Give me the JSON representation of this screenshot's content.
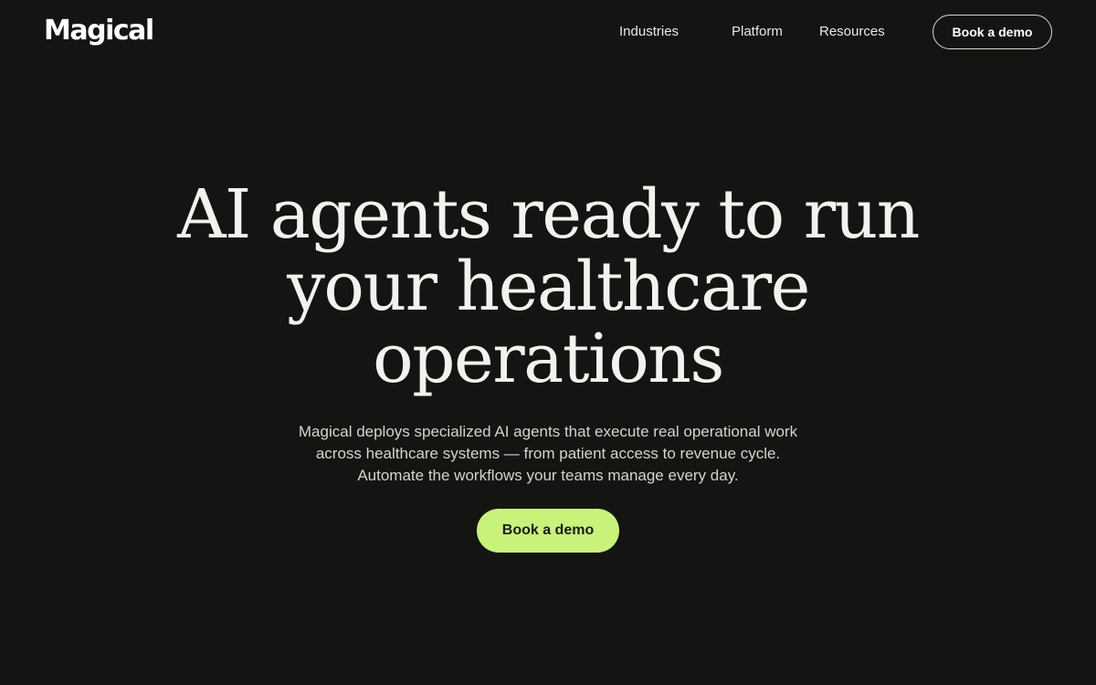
{
  "header": {
    "logo_text": "Magical",
    "nav": {
      "industries": "Industries",
      "platform": "Platform",
      "resources": "Resources"
    },
    "cta_label": "Book a demo"
  },
  "hero": {
    "title": "AI agents ready to run your healthcare operations",
    "subtitle": "Magical deploys specialized AI agents that execute real operational work across healthcare systems — from patient access to revenue cycle. Automate the workflows your teams manage every day.",
    "cta_label": "Book a demo"
  },
  "colors": {
    "background": "#141412",
    "accent": "#c9f27a",
    "text": "#f2f2ee"
  }
}
